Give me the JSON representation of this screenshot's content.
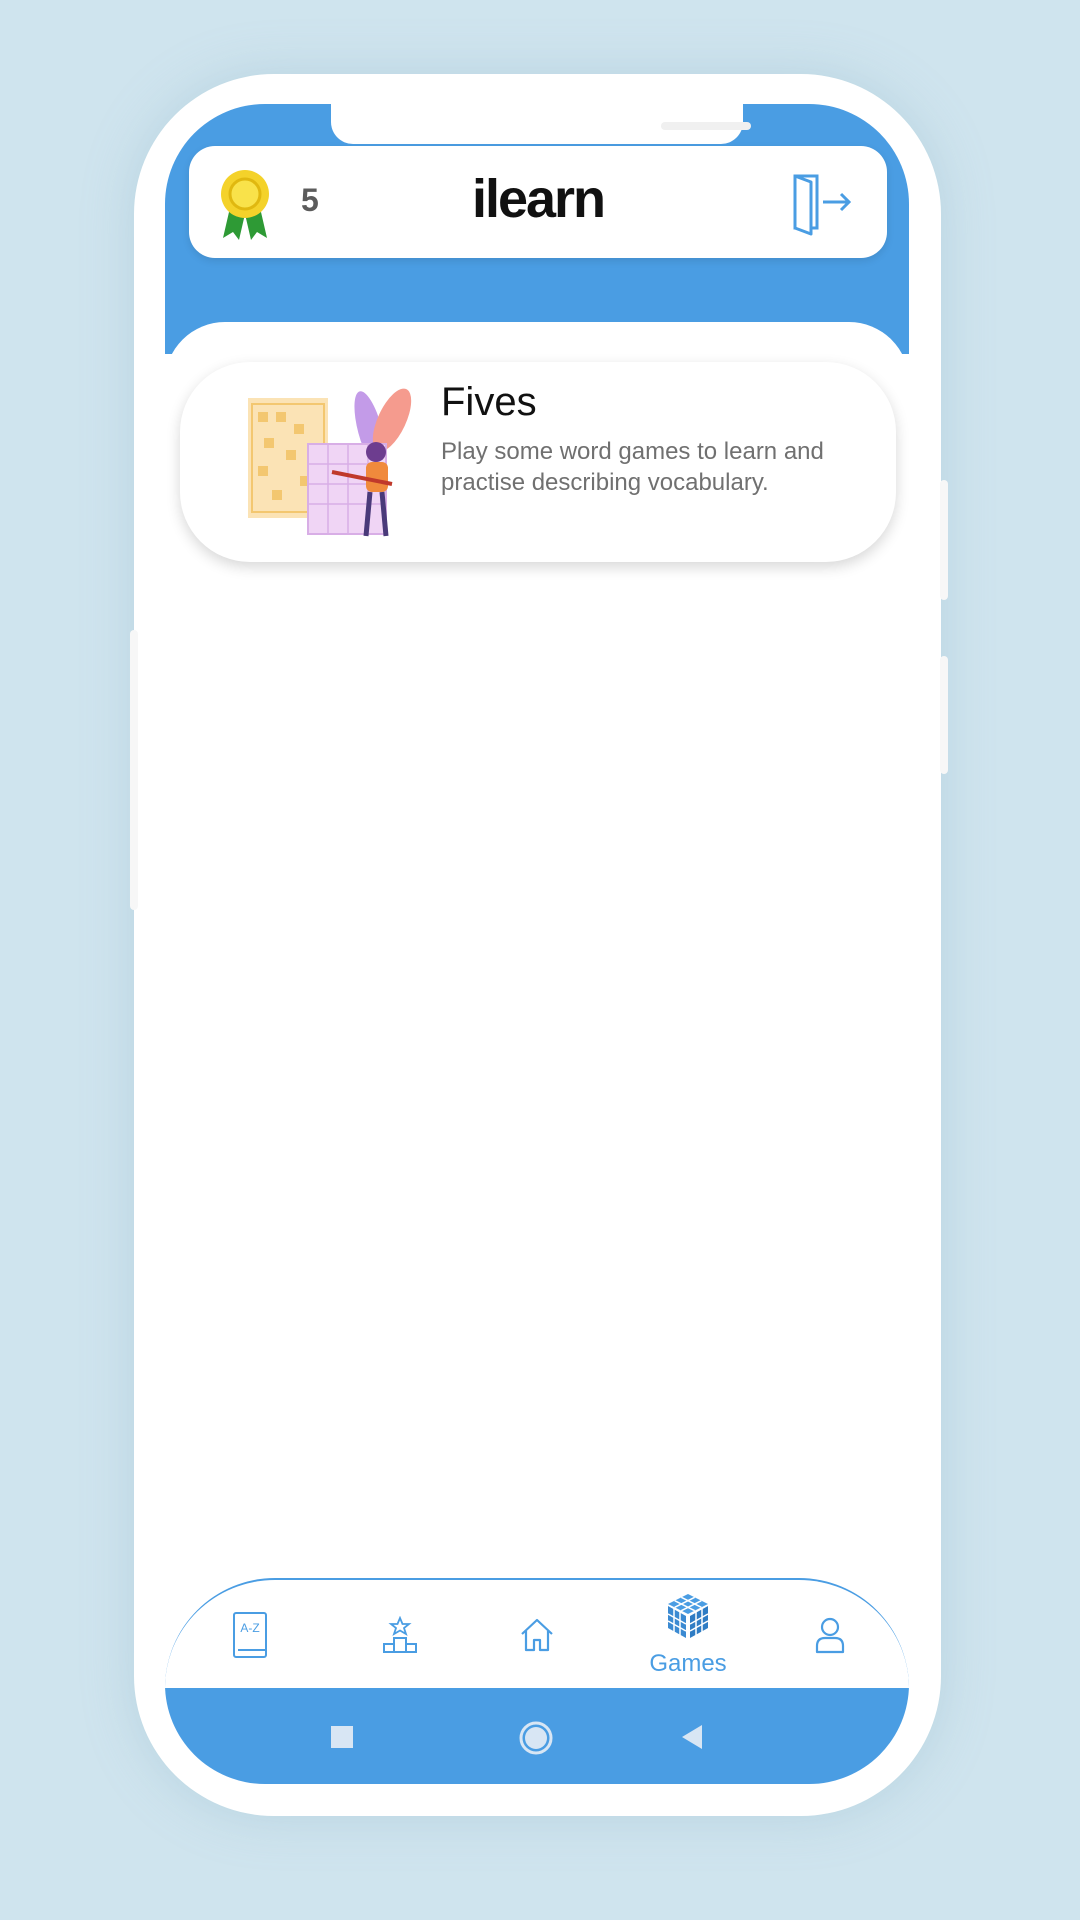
{
  "header": {
    "score": "5",
    "logo": "ilearn",
    "medal_icon": "medal-icon",
    "logout_icon": "logout-door-icon"
  },
  "games": [
    {
      "title": "Fives",
      "description": "Play some word games to learn and practise describing vocabulary.",
      "illustration": "word-puzzle-illustration"
    }
  ],
  "bottom_nav": {
    "items": [
      {
        "icon": "dictionary-az-icon",
        "label": ""
      },
      {
        "icon": "leaderboard-podium-icon",
        "label": ""
      },
      {
        "icon": "home-icon",
        "label": ""
      },
      {
        "icon": "games-cube-icon",
        "label": "Games",
        "active": true
      },
      {
        "icon": "profile-icon",
        "label": ""
      }
    ],
    "az_text": "A-Z"
  },
  "colors": {
    "primary": "#4a9de3",
    "background": "#cfe4ee",
    "medal_gold": "#f4d22a",
    "ribbon_green": "#2e9a35"
  }
}
